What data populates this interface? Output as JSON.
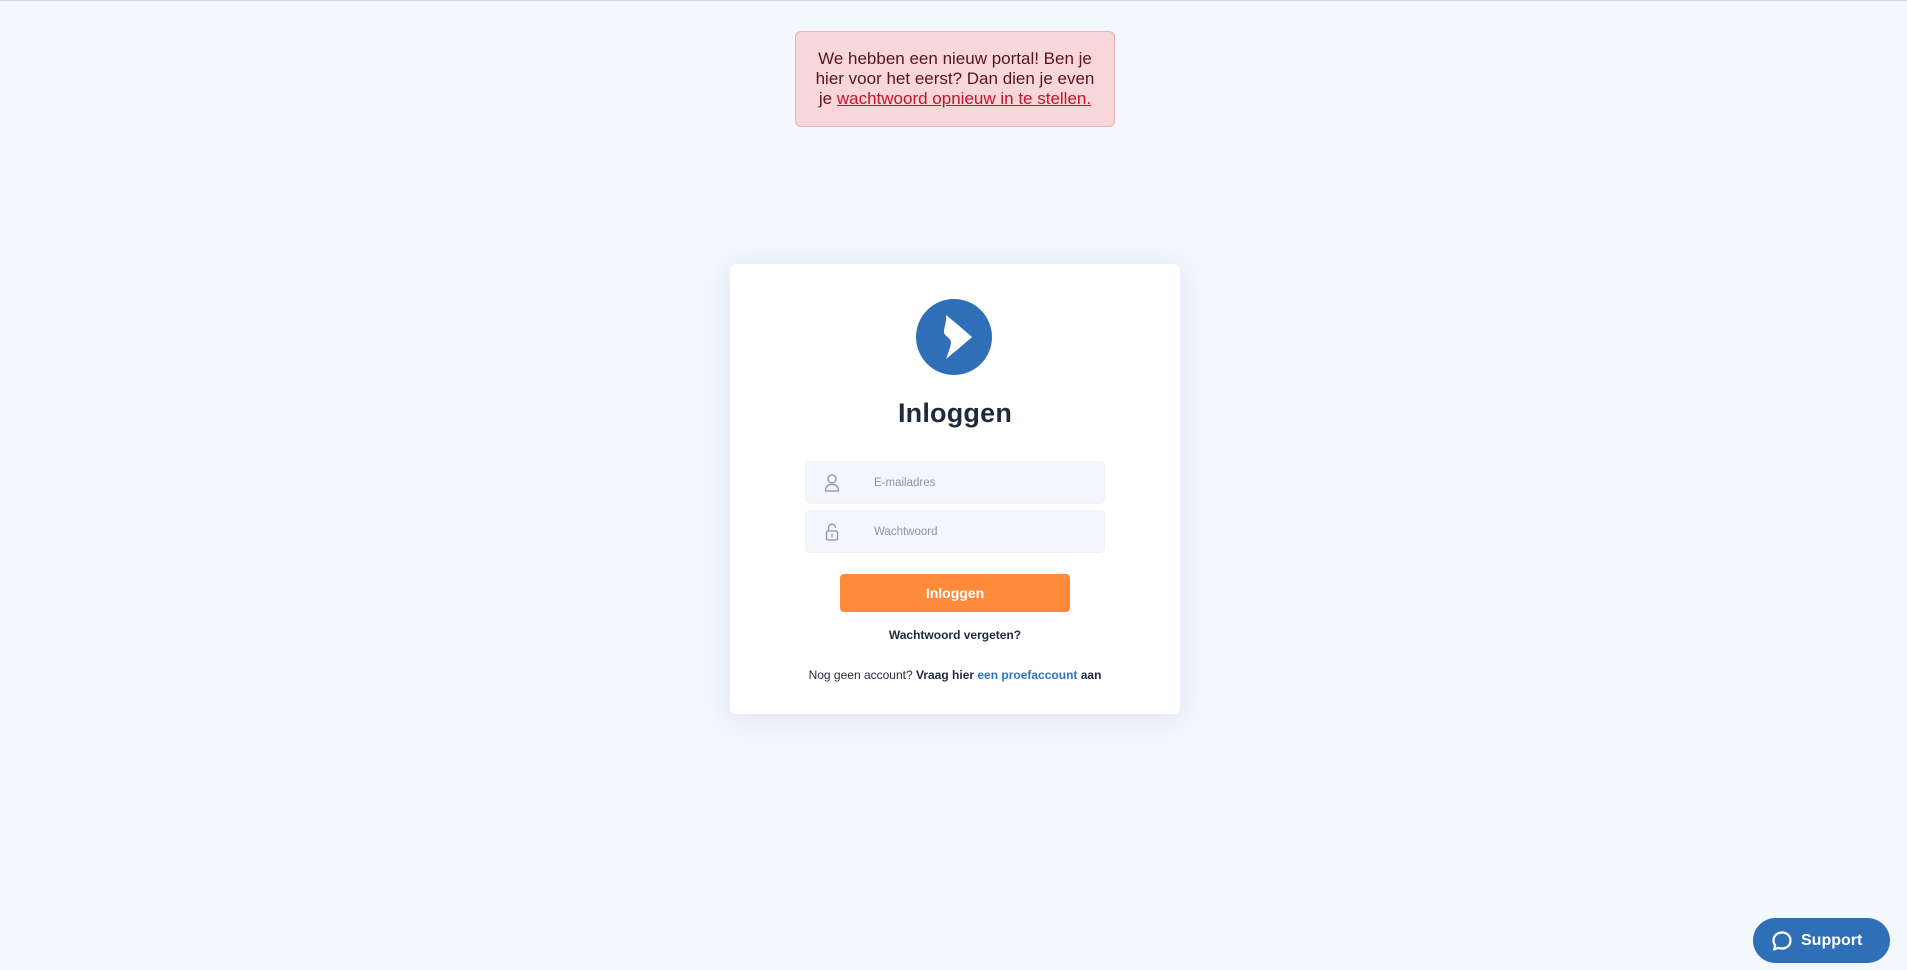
{
  "alert": {
    "text": "We hebben een nieuw portal! Ben je hier voor het eerst? Dan dien je even je ",
    "link_text": "wachtwoord opnieuw in te stellen."
  },
  "login": {
    "title": "Inloggen",
    "email_placeholder": "E-mailadres",
    "password_placeholder": "Wachtwoord",
    "submit_label": "Inloggen",
    "forgot_label": "Wachtwoord vergeten?",
    "signup_prefix": "Nog geen account? ",
    "signup_bold": "Vraag hier ",
    "signup_link": "een proefaccount",
    "signup_suffix": " aan"
  },
  "support": {
    "label": "Support"
  },
  "colors": {
    "background": "#f3f7fe",
    "brand_blue": "#2f6fb8",
    "accent_orange": "#ff8a3a",
    "alert_bg": "#f8d7da",
    "alert_link": "#c8102e"
  },
  "icons": {
    "logo": "brand-logo-icon",
    "email": "user-icon",
    "password": "lock-icon",
    "support": "chat-bubble-icon"
  }
}
